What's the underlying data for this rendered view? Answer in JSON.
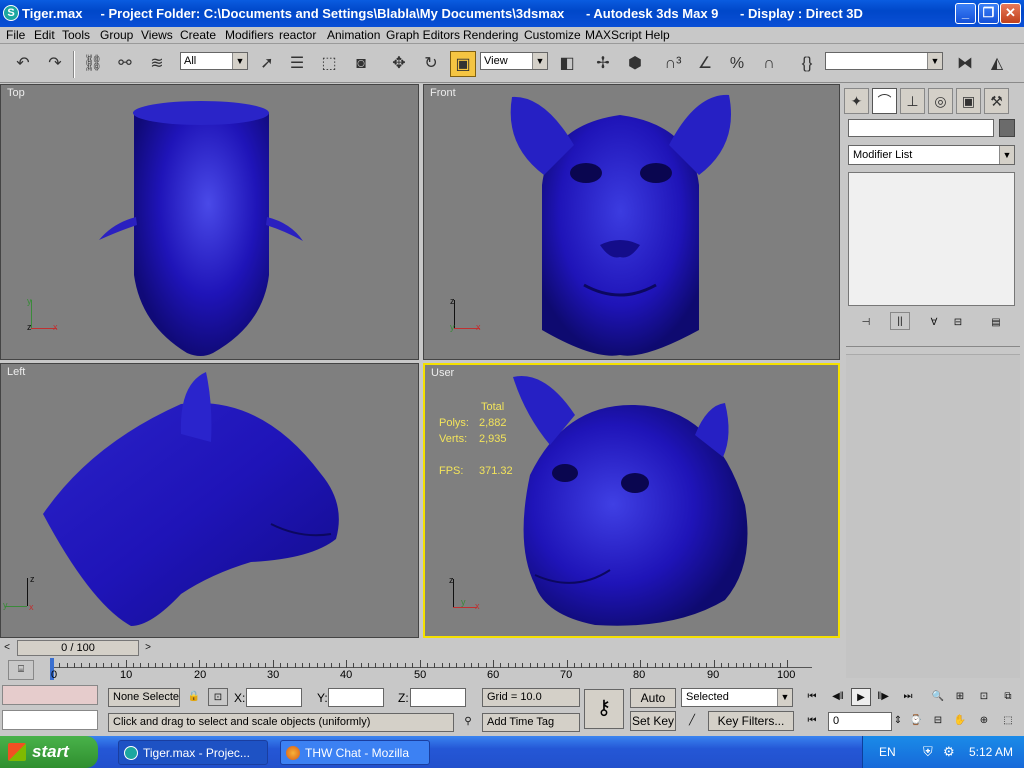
{
  "window": {
    "title": "Tiger.max     - Project Folder: C:\\Documents and Settings\\Blabla\\My Documents\\3dsmax      - Autodesk 3ds Max 9      - Display : Direct 3D",
    "app_icon": "3ds-max-icon"
  },
  "menu": [
    "File",
    "Edit",
    "Tools",
    "Group",
    "Views",
    "Create",
    "Modifiers",
    "reactor",
    "Animation",
    "Graph Editors",
    "Rendering",
    "Customize",
    "MAXScript",
    "Help"
  ],
  "toolbar": {
    "selection_filter": "All",
    "ref_coord": "View",
    "named_selection": ""
  },
  "viewports": {
    "top": {
      "label": "Top"
    },
    "front": {
      "label": "Front"
    },
    "left": {
      "label": "Left"
    },
    "user": {
      "label": "User",
      "stats_header": "Total",
      "polys_label": "Polys:",
      "polys": "2,882",
      "verts_label": "Verts:",
      "verts": "2,935",
      "fps_label": "FPS:",
      "fps": "371.32"
    }
  },
  "command_panel": {
    "object_name": "",
    "modifier_list": "Modifier List"
  },
  "timeline": {
    "frame_readout": "0 / 100",
    "labels": [
      "0",
      "10",
      "20",
      "30",
      "40",
      "50",
      "60",
      "70",
      "80",
      "90",
      "100"
    ],
    "current_frame": 0
  },
  "status": {
    "selection": "None Selecte",
    "x_label": "X:",
    "y_label": "Y:",
    "z_label": "Z:",
    "grid": "Grid = 10.0",
    "prompt": "Click and drag to select and scale objects (uniformly)",
    "add_time_tag": "Add Time Tag",
    "auto_key": "Auto Key",
    "set_key": "Set Key",
    "key_mode": "Selected",
    "key_filters": "Key Filters...",
    "frame": "0"
  },
  "taskbar": {
    "start": "start",
    "tasks": [
      {
        "label": "Tiger.max     - Projec...",
        "icon": "3ds-max-icon"
      },
      {
        "label": "THW Chat - Mozilla Fi...",
        "icon": "firefox-icon"
      }
    ],
    "language": "EN",
    "clock": "5:12 AM"
  },
  "colors": {
    "model_blue": "#1f14b8",
    "viewport_bg": "#7f7f7f",
    "active_border": "#f5e100",
    "stats_text": "#f3e45b"
  }
}
